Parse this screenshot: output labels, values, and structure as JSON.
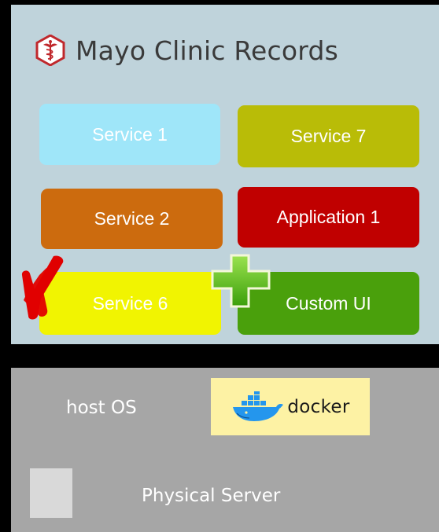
{
  "header": {
    "title": "Mayo Clinic Records",
    "logo_icon": "caduceus-icon"
  },
  "services": {
    "service1": "Service 1",
    "service7": "Service 7",
    "service2": "Service 2",
    "application1": "Application 1",
    "service6": "Service 6",
    "custom_ui": "Custom UI"
  },
  "markers": {
    "removed_icon": "red-x-icon",
    "added_icon": "green-plus-icon"
  },
  "host": {
    "label": "host OS",
    "docker_label": "docker",
    "docker_icon": "docker-whale-icon"
  },
  "server": {
    "label": "Physical Server"
  },
  "colors": {
    "app_layer": "#bfd3db",
    "service1": "#9fe6f9",
    "service7": "#b9bc07",
    "service2": "#cc6b0e",
    "application1": "#c00000",
    "service6": "#f1f401",
    "custom_ui": "#4aa00c",
    "host_layer": "#a6a6a6",
    "docker_box": "#fdf2a4"
  }
}
